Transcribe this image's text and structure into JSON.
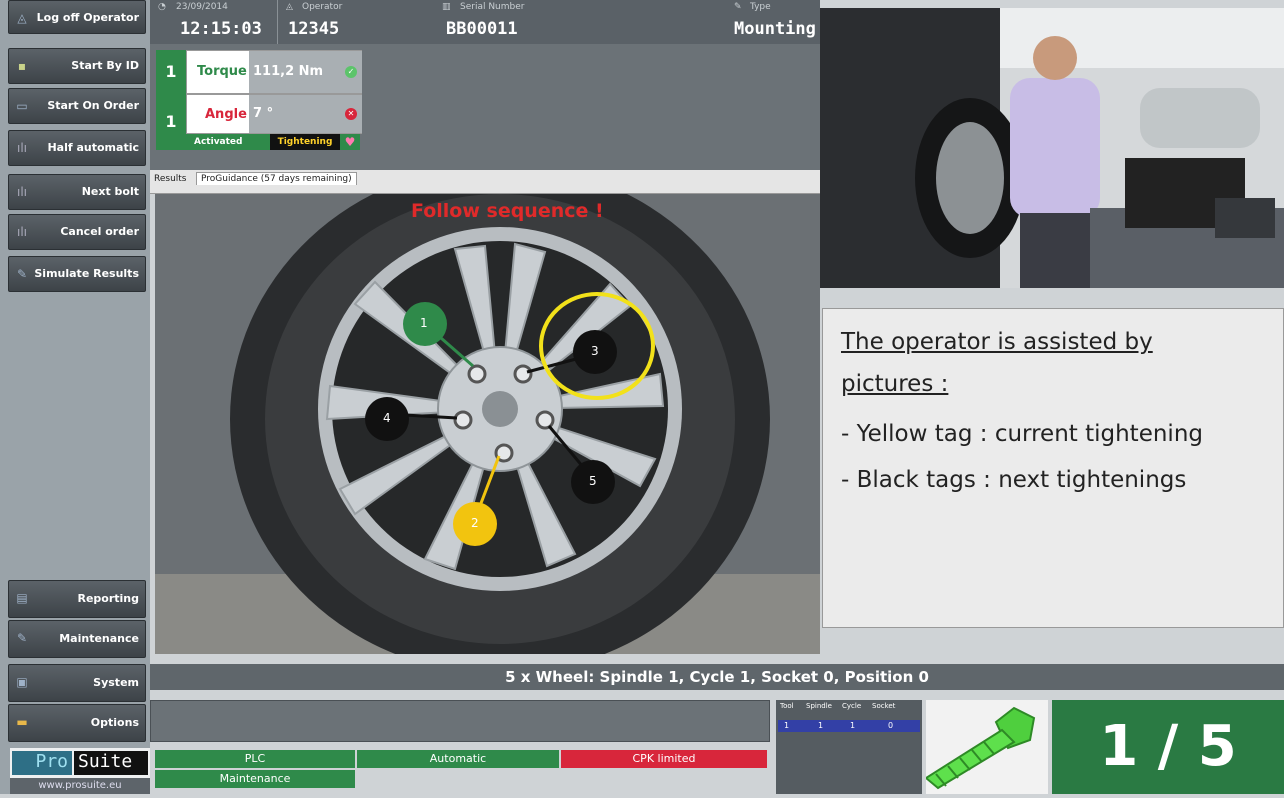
{
  "sidebar": {
    "buttons": [
      {
        "label": "Log off Operator",
        "icon": "user-icon"
      },
      {
        "label": "Start By ID",
        "icon": "id-icon"
      },
      {
        "label": "Start On Order",
        "icon": "order-icon"
      },
      {
        "label": "Half automatic",
        "icon": "chart-icon"
      },
      {
        "label": "Next bolt",
        "icon": "chart-icon"
      },
      {
        "label": "Cancel order",
        "icon": "chart-icon"
      },
      {
        "label": "Simulate Results",
        "icon": "wrench-icon"
      }
    ],
    "bottom_buttons": [
      {
        "label": "Reporting"
      },
      {
        "label": "Maintenance"
      },
      {
        "label": "System"
      },
      {
        "label": "Options"
      }
    ],
    "logo_pro": "Pro",
    "logo_suite": "Suite",
    "website": "www.prosuite.eu"
  },
  "header": {
    "date_caption": "23/09/2014",
    "time": "12:15:03",
    "operator_caption": "Operator",
    "operator": "12345",
    "serial_caption": "Serial Number",
    "serial": "BB00011",
    "type_caption": "Type",
    "type": "Mounting"
  },
  "results": {
    "torque": {
      "index": "1",
      "label": "Torque",
      "value": "111,2 Nm"
    },
    "angle": {
      "index": "1",
      "label": "Angle",
      "value": "7 °"
    },
    "status_activated": "Activated",
    "status_tightening": "Tightening"
  },
  "tabs": {
    "results": "Results",
    "proguidance": "ProGuidance (57 days remaining)"
  },
  "wheel": {
    "instruction": "Follow sequence !",
    "tags": [
      "1",
      "2",
      "3",
      "4",
      "5"
    ]
  },
  "note": {
    "heading_line1": "The operator is assisted by",
    "heading_line2": "pictures :",
    "line1": "- Yellow tag : current tightening",
    "line2": "- Black tags : next tightenings"
  },
  "banner": "5 x Wheel: Spindle  1, Cycle 1, Socket 0, Position 0",
  "status": {
    "plc": "PLC",
    "automatic": "Automatic",
    "cpk": "CPK limited",
    "maintenance": "Maintenance"
  },
  "tsc": {
    "headers": [
      "Tool",
      "Spindle",
      "Cycle",
      "Socket"
    ],
    "values": [
      "1",
      "1",
      "1",
      "0"
    ]
  },
  "counter": "1 / 5",
  "colors": {
    "green": "#2f8a4a",
    "red": "#d8263b",
    "yellow": "#f2c40f"
  }
}
